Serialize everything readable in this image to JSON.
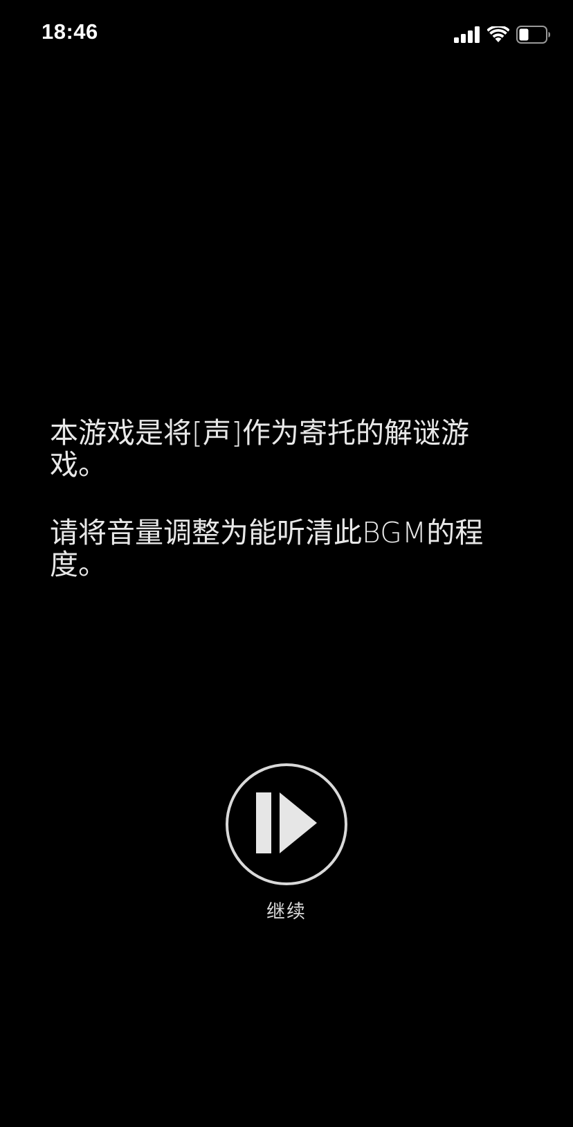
{
  "status_bar": {
    "time": "18:46",
    "icons": [
      "cellular-signal-icon",
      "wifi-icon",
      "battery-icon"
    ]
  },
  "message": {
    "paragraph1": "本游戏是将[声]作为寄托的解谜游戏。",
    "paragraph2": "请将音量调整为能听清此BGM的程度。"
  },
  "continue": {
    "icon": "play-resume-icon",
    "label": "继续"
  },
  "colors": {
    "background": "#000000",
    "text": "#e8e8e8",
    "button": "#d9d9d9"
  }
}
